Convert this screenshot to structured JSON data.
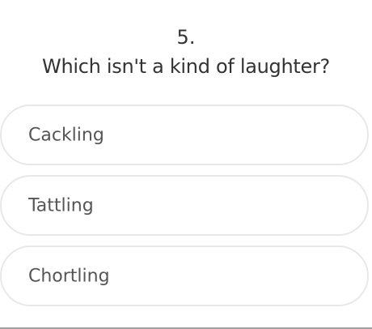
{
  "question": {
    "number": "5.",
    "text": "Which isn't a kind of laughter?"
  },
  "options": [
    {
      "label": "Cackling"
    },
    {
      "label": "Tattling"
    },
    {
      "label": "Chortling"
    }
  ]
}
